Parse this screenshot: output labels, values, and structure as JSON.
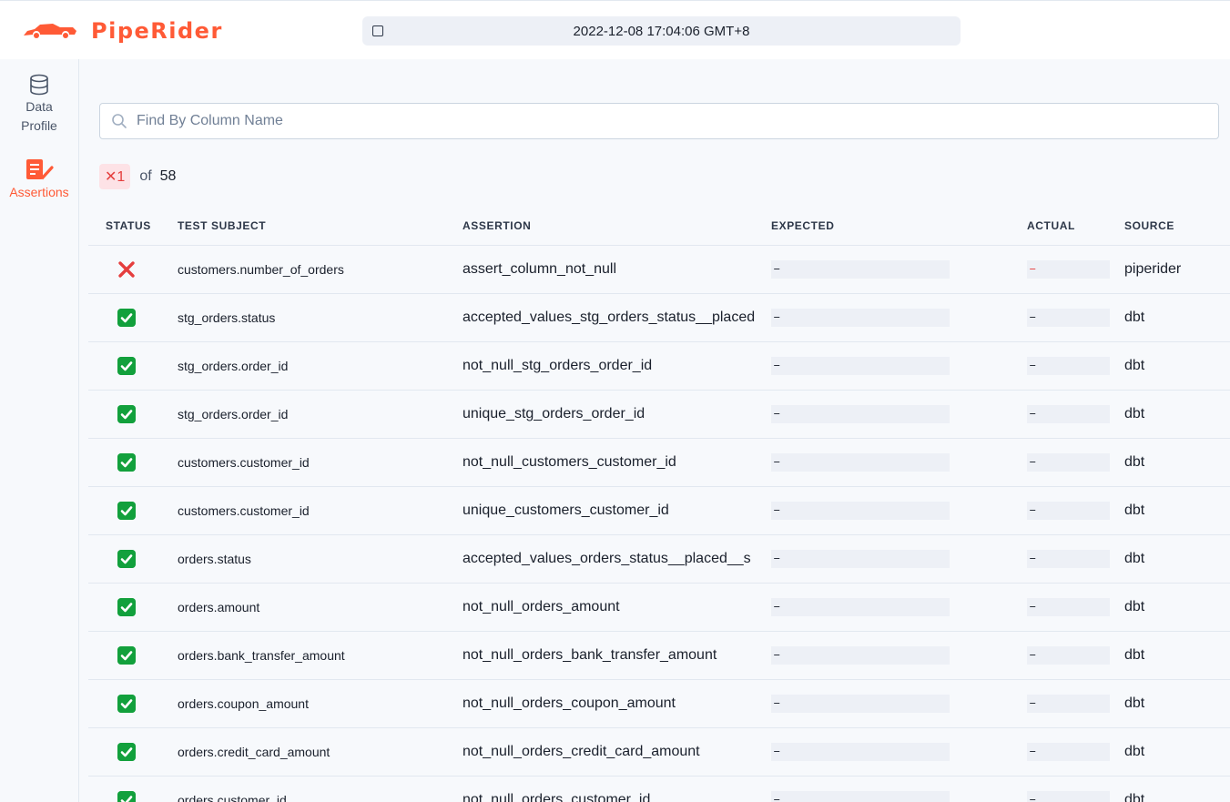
{
  "app": {
    "name": "PipeRider",
    "brand_color": "#ff5a36"
  },
  "header": {
    "timestamp": "2022-12-08 17:04:06 GMT+8"
  },
  "sidebar": {
    "items": [
      {
        "label_line1": "Data",
        "label_line2": "Profile",
        "icon": "database-icon",
        "active": false
      },
      {
        "label": "Assertions",
        "icon": "assertions-icon",
        "active": true
      }
    ]
  },
  "search": {
    "placeholder": "Find By Column Name",
    "value": ""
  },
  "summary": {
    "failed": "✕1",
    "of": "of",
    "total": "58"
  },
  "table": {
    "headers": {
      "status": "STATUS",
      "subject": "TEST SUBJECT",
      "assertion": "ASSERTION",
      "expected": "EXPECTED",
      "actual": "ACTUAL",
      "source": "SOURCE"
    },
    "rows": [
      {
        "status": "failed",
        "subject": "customers.number_of_orders",
        "assertion": "assert_column_not_null",
        "expected": "–",
        "actual": "–",
        "source": "piperider"
      },
      {
        "status": "passed",
        "subject": "stg_orders.status",
        "assertion": "accepted_values_stg_orders_status__placed",
        "expected": "–",
        "actual": "–",
        "source": "dbt"
      },
      {
        "status": "passed",
        "subject": "stg_orders.order_id",
        "assertion": "not_null_stg_orders_order_id",
        "expected": "–",
        "actual": "–",
        "source": "dbt"
      },
      {
        "status": "passed",
        "subject": "stg_orders.order_id",
        "assertion": "unique_stg_orders_order_id",
        "expected": "–",
        "actual": "–",
        "source": "dbt"
      },
      {
        "status": "passed",
        "subject": "customers.customer_id",
        "assertion": "not_null_customers_customer_id",
        "expected": "–",
        "actual": "–",
        "source": "dbt"
      },
      {
        "status": "passed",
        "subject": "customers.customer_id",
        "assertion": "unique_customers_customer_id",
        "expected": "–",
        "actual": "–",
        "source": "dbt"
      },
      {
        "status": "passed",
        "subject": "orders.status",
        "assertion": "accepted_values_orders_status__placed__s",
        "expected": "–",
        "actual": "–",
        "source": "dbt"
      },
      {
        "status": "passed",
        "subject": "orders.amount",
        "assertion": "not_null_orders_amount",
        "expected": "–",
        "actual": "–",
        "source": "dbt"
      },
      {
        "status": "passed",
        "subject": "orders.bank_transfer_amount",
        "assertion": "not_null_orders_bank_transfer_amount",
        "expected": "–",
        "actual": "–",
        "source": "dbt"
      },
      {
        "status": "passed",
        "subject": "orders.coupon_amount",
        "assertion": "not_null_orders_coupon_amount",
        "expected": "–",
        "actual": "–",
        "source": "dbt"
      },
      {
        "status": "passed",
        "subject": "orders.credit_card_amount",
        "assertion": "not_null_orders_credit_card_amount",
        "expected": "–",
        "actual": "–",
        "source": "dbt"
      },
      {
        "status": "passed",
        "subject": "orders.customer_id",
        "assertion": "not_null_orders_customer_id",
        "expected": "–",
        "actual": "–",
        "source": "dbt"
      }
    ]
  },
  "colors": {
    "pass": "#12a03c",
    "fail": "#e53e3e",
    "badge_bg": "#fde2e6"
  }
}
